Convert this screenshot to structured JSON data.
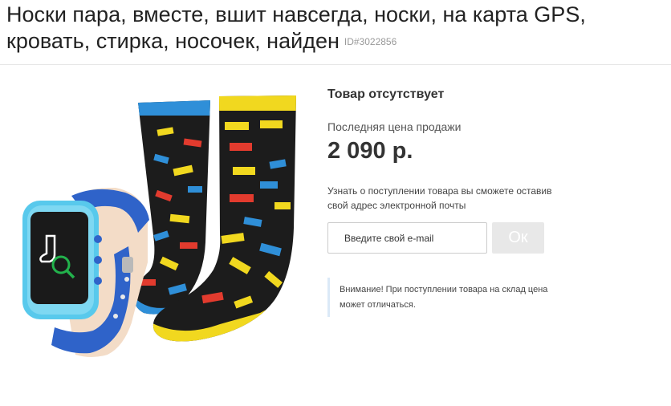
{
  "product": {
    "title": "Носки пара, вместе, вшит навсегда, носки, на карта GPS, кровать, стирка, носочек, найден",
    "id_label": "ID#3022856"
  },
  "availability": {
    "status": "Товар отсутствует",
    "last_price_label": "Последняя цена продажи",
    "last_price": "2 090 р."
  },
  "notify": {
    "text": "Узнать о поступлении товара вы сможете оставив свой адрес электронной почты",
    "email_placeholder": "Введите свой e-mail",
    "email_value": "",
    "submit_label": "Ок"
  },
  "notice": {
    "text": "Внимание! При поступлении товара на склад цена может отличаться."
  },
  "colors": {
    "sock_base": "#1a1a1a",
    "sock_cuff_left": "#2f8fd8",
    "sock_cuff_right": "#f1d81f",
    "watch_strap": "#2f63c9",
    "watch_case": "#58c9ec",
    "notice_border": "#dbe9f7"
  }
}
